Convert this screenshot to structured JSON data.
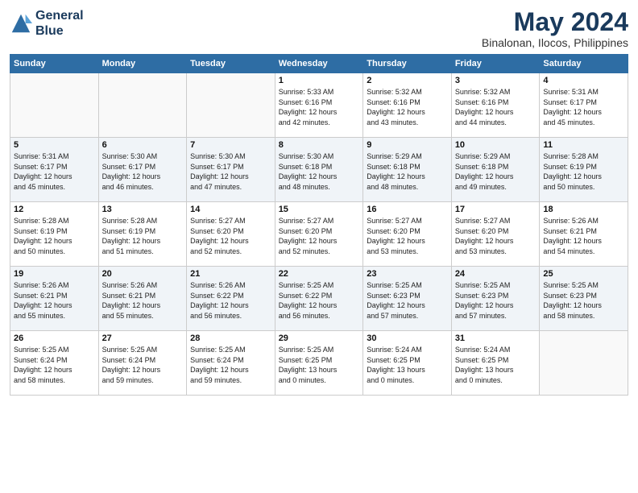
{
  "header": {
    "logo_line1": "General",
    "logo_line2": "Blue",
    "month": "May 2024",
    "location": "Binalonan, Ilocos, Philippines"
  },
  "weekdays": [
    "Sunday",
    "Monday",
    "Tuesday",
    "Wednesday",
    "Thursday",
    "Friday",
    "Saturday"
  ],
  "weeks": [
    [
      {
        "day": "",
        "detail": ""
      },
      {
        "day": "",
        "detail": ""
      },
      {
        "day": "",
        "detail": ""
      },
      {
        "day": "1",
        "detail": "Sunrise: 5:33 AM\nSunset: 6:16 PM\nDaylight: 12 hours\nand 42 minutes."
      },
      {
        "day": "2",
        "detail": "Sunrise: 5:32 AM\nSunset: 6:16 PM\nDaylight: 12 hours\nand 43 minutes."
      },
      {
        "day": "3",
        "detail": "Sunrise: 5:32 AM\nSunset: 6:16 PM\nDaylight: 12 hours\nand 44 minutes."
      },
      {
        "day": "4",
        "detail": "Sunrise: 5:31 AM\nSunset: 6:17 PM\nDaylight: 12 hours\nand 45 minutes."
      }
    ],
    [
      {
        "day": "5",
        "detail": "Sunrise: 5:31 AM\nSunset: 6:17 PM\nDaylight: 12 hours\nand 45 minutes."
      },
      {
        "day": "6",
        "detail": "Sunrise: 5:30 AM\nSunset: 6:17 PM\nDaylight: 12 hours\nand 46 minutes."
      },
      {
        "day": "7",
        "detail": "Sunrise: 5:30 AM\nSunset: 6:17 PM\nDaylight: 12 hours\nand 47 minutes."
      },
      {
        "day": "8",
        "detail": "Sunrise: 5:30 AM\nSunset: 6:18 PM\nDaylight: 12 hours\nand 48 minutes."
      },
      {
        "day": "9",
        "detail": "Sunrise: 5:29 AM\nSunset: 6:18 PM\nDaylight: 12 hours\nand 48 minutes."
      },
      {
        "day": "10",
        "detail": "Sunrise: 5:29 AM\nSunset: 6:18 PM\nDaylight: 12 hours\nand 49 minutes."
      },
      {
        "day": "11",
        "detail": "Sunrise: 5:28 AM\nSunset: 6:19 PM\nDaylight: 12 hours\nand 50 minutes."
      }
    ],
    [
      {
        "day": "12",
        "detail": "Sunrise: 5:28 AM\nSunset: 6:19 PM\nDaylight: 12 hours\nand 50 minutes."
      },
      {
        "day": "13",
        "detail": "Sunrise: 5:28 AM\nSunset: 6:19 PM\nDaylight: 12 hours\nand 51 minutes."
      },
      {
        "day": "14",
        "detail": "Sunrise: 5:27 AM\nSunset: 6:20 PM\nDaylight: 12 hours\nand 52 minutes."
      },
      {
        "day": "15",
        "detail": "Sunrise: 5:27 AM\nSunset: 6:20 PM\nDaylight: 12 hours\nand 52 minutes."
      },
      {
        "day": "16",
        "detail": "Sunrise: 5:27 AM\nSunset: 6:20 PM\nDaylight: 12 hours\nand 53 minutes."
      },
      {
        "day": "17",
        "detail": "Sunrise: 5:27 AM\nSunset: 6:20 PM\nDaylight: 12 hours\nand 53 minutes."
      },
      {
        "day": "18",
        "detail": "Sunrise: 5:26 AM\nSunset: 6:21 PM\nDaylight: 12 hours\nand 54 minutes."
      }
    ],
    [
      {
        "day": "19",
        "detail": "Sunrise: 5:26 AM\nSunset: 6:21 PM\nDaylight: 12 hours\nand 55 minutes."
      },
      {
        "day": "20",
        "detail": "Sunrise: 5:26 AM\nSunset: 6:21 PM\nDaylight: 12 hours\nand 55 minutes."
      },
      {
        "day": "21",
        "detail": "Sunrise: 5:26 AM\nSunset: 6:22 PM\nDaylight: 12 hours\nand 56 minutes."
      },
      {
        "day": "22",
        "detail": "Sunrise: 5:25 AM\nSunset: 6:22 PM\nDaylight: 12 hours\nand 56 minutes."
      },
      {
        "day": "23",
        "detail": "Sunrise: 5:25 AM\nSunset: 6:23 PM\nDaylight: 12 hours\nand 57 minutes."
      },
      {
        "day": "24",
        "detail": "Sunrise: 5:25 AM\nSunset: 6:23 PM\nDaylight: 12 hours\nand 57 minutes."
      },
      {
        "day": "25",
        "detail": "Sunrise: 5:25 AM\nSunset: 6:23 PM\nDaylight: 12 hours\nand 58 minutes."
      }
    ],
    [
      {
        "day": "26",
        "detail": "Sunrise: 5:25 AM\nSunset: 6:24 PM\nDaylight: 12 hours\nand 58 minutes."
      },
      {
        "day": "27",
        "detail": "Sunrise: 5:25 AM\nSunset: 6:24 PM\nDaylight: 12 hours\nand 59 minutes."
      },
      {
        "day": "28",
        "detail": "Sunrise: 5:25 AM\nSunset: 6:24 PM\nDaylight: 12 hours\nand 59 minutes."
      },
      {
        "day": "29",
        "detail": "Sunrise: 5:25 AM\nSunset: 6:25 PM\nDaylight: 13 hours\nand 0 minutes."
      },
      {
        "day": "30",
        "detail": "Sunrise: 5:24 AM\nSunset: 6:25 PM\nDaylight: 13 hours\nand 0 minutes."
      },
      {
        "day": "31",
        "detail": "Sunrise: 5:24 AM\nSunset: 6:25 PM\nDaylight: 13 hours\nand 0 minutes."
      },
      {
        "day": "",
        "detail": ""
      }
    ]
  ]
}
